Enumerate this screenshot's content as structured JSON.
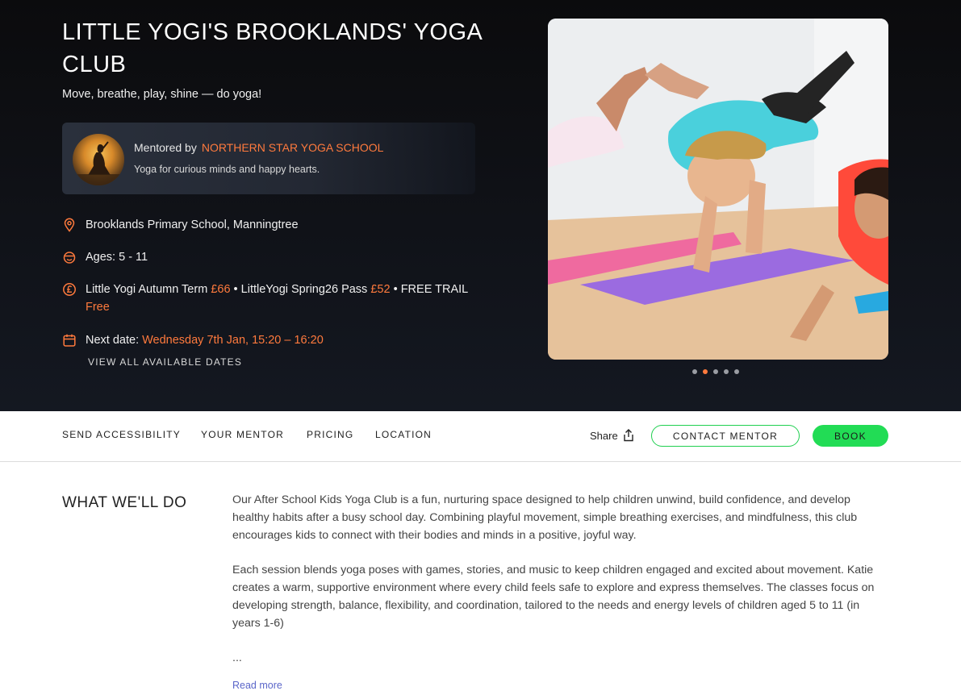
{
  "hero": {
    "title": "LITTLE YOGI'S BROOKLANDS' YOGA CLUB",
    "subtitle": "Move, breathe, play, shine — do yoga!",
    "mentor": {
      "prefix": "Mentored by",
      "name": "NORTHERN STAR YOGA SCHOOL",
      "tagline": "Yoga for curious minds and happy hearts."
    },
    "location": "Brooklands Primary School, Manningtree",
    "ages": "Ages: 5 - 11",
    "pricing": {
      "item1_name": "Little Yogi Autumn Term",
      "item1_price": "£66",
      "item2_name": "LittleYogi Spring26 Pass",
      "item2_price": "£52",
      "item3_name": "FREE TRAIL",
      "item3_price": "Free",
      "separator": "•"
    },
    "next_date": {
      "label": "Next date:",
      "value": "Wednesday 7th Jan, 15:20 – 16:20"
    },
    "view_all": "VIEW ALL AVAILABLE DATES",
    "carousel": {
      "total": 5,
      "active_index": 1
    }
  },
  "nav": {
    "links": [
      "SEND ACCESSIBILITY",
      "YOUR MENTOR",
      "PRICING",
      "LOCATION"
    ],
    "share": "Share",
    "contact_label": "CONTACT MENTOR",
    "book_label": "BOOK"
  },
  "about": {
    "title": "WHAT WE'LL DO",
    "paragraph1": "Our After School Kids Yoga Club is a fun, nurturing space designed to help children unwind, build confidence, and develop healthy habits after a busy school day. Combining playful movement, simple breathing exercises, and mindfulness, this club encourages kids to connect with their bodies and minds in a positive, joyful way.",
    "paragraph2": "Each session blends yoga poses with games, stories, and music to keep children engaged and excited about movement. Katie creates a warm, supportive environment where every child feels safe to explore and express themselves. The classes focus on developing strength, balance, flexibility, and coordination, tailored to the needs and energy levels of children aged 5 to 11 (in years 1-6)",
    "ellipsis": "...",
    "read_more": "Read more"
  },
  "colors": {
    "accent": "#ff7a3d",
    "brand_green": "#22dc55",
    "link": "#5b66c9"
  }
}
